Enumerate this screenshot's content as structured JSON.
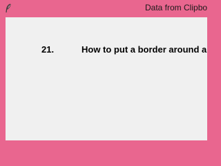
{
  "window": {
    "title": "Data from Clipboard",
    "icon": "feather-icon",
    "border_color": "#e9668f",
    "background_color": "#f0f0f0"
  },
  "content": {
    "number": "21.",
    "text": "How to put a border around a Frame in Python Tkinter"
  }
}
